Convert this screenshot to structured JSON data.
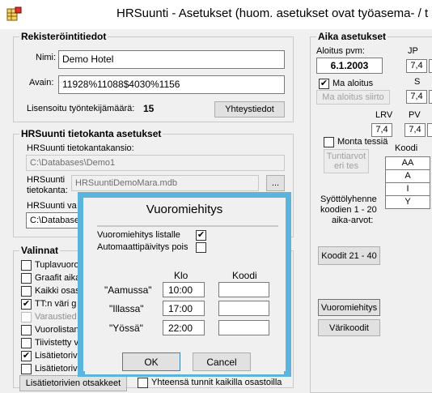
{
  "window": {
    "title": "HRSuunti - Asetukset  (huom. asetukset ovat työasema- / t"
  },
  "registration": {
    "group_title": "Rekisteröintitiedot",
    "name_label": "Nimi:",
    "name_value": "Demo Hotel",
    "key_label": "Avain:",
    "key_value": "11928%11088$4030%1156",
    "licensed_label": "Lisensoitu työntekijämäärä:",
    "licensed_count": "15",
    "contact_button": "Yhteystiedot"
  },
  "database": {
    "group_title": "HRSuunti tietokanta asetukset",
    "folder_label": "HRSuunti tietokantakansio:",
    "folder_value": "C:\\Databases\\Demo1",
    "db_label_1": "HRSuunti",
    "db_label_2": "tietokanta:",
    "db_value": "HRSuuntiDemoMara.mdb",
    "browse_button": "...",
    "var_label": "HRSuunti va",
    "var_value": "C:\\Databases"
  },
  "choices": {
    "group_title": "Valinnat",
    "items": [
      {
        "label": "Tuplavuoro",
        "checked": "",
        "disabled": false
      },
      {
        "label": "Graafit aika",
        "checked": "",
        "disabled": false
      },
      {
        "label": "Kaikki osas",
        "checked": "",
        "disabled": false
      },
      {
        "label": "TT:n väri g",
        "checked": "✔",
        "disabled": false
      },
      {
        "label": "Varaustied",
        "checked": "",
        "disabled": true
      },
      {
        "label": "Vuorolistan",
        "checked": "",
        "disabled": false
      },
      {
        "label": "Tiivistetty v",
        "checked": "",
        "disabled": false
      },
      {
        "label": "Lisätietorivi",
        "checked": "✔",
        "disabled": false
      },
      {
        "label": "Lisätietorivi",
        "checked": "",
        "disabled": false
      }
    ],
    "headers_button": "Lisätietorivien otsakkeet",
    "bottom_checkbox_label": "Yhteensä tunnit kaikilla osastoilla"
  },
  "time_settings": {
    "group_title": "Aika asetukset",
    "start_date_label": "Aloitus pvm:",
    "start_date_value": "6.1.2003",
    "jp_label": "JP",
    "jp_value": "7,4",
    "ma_start_label": "Ma aloitus",
    "ma_start_checked": "✔",
    "s_label": "S",
    "s_value": "7,4",
    "ma_shift_button": "Ma aloitus siirto",
    "lrv_label": "LRV",
    "pv_label": "PV",
    "lrv_value": "7,4",
    "pv_value": "7,4",
    "multi_label": "Monta tessiä",
    "defaults_button_1": "Tuntiarvot",
    "defaults_button_2": "eri tes",
    "code_header": "Koodi",
    "codes": [
      "AA",
      "A",
      "I",
      "Y"
    ],
    "input_hint_1": "Syöttölyhenne",
    "input_hint_2": "koodien 1 - 20",
    "input_hint_3": "aika-arvot:",
    "codes_button": "Koodit 21 - 40",
    "shift_naming_button": "Vuoromiehitys",
    "color_codes_button": "Värikoodit"
  },
  "dialog": {
    "title": "Vuoromiehitys",
    "list_label": "Vuoromiehitys listalle",
    "list_checked": "✔",
    "auto_label": "Automaattipäivitys pois",
    "auto_checked": "",
    "col_time": "Klo",
    "col_code": "Koodi",
    "rows": [
      {
        "label": "\"Aamussa\"",
        "time": "10:00",
        "code": ""
      },
      {
        "label": "\"Illassa\"",
        "time": "17:00",
        "code": ""
      },
      {
        "label": "\"Yössä\"",
        "time": "22:00",
        "code": ""
      }
    ],
    "ok_button": "OK",
    "cancel_button": "Cancel"
  }
}
